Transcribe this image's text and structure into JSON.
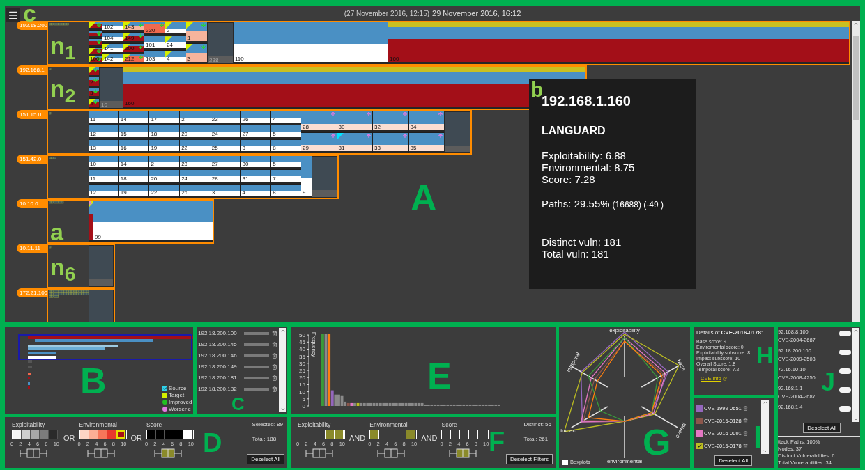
{
  "main": {
    "note": "A",
    "menu_note": "c",
    "previous_time": "(27 November 2016, 12:15)",
    "current_time": "29 November 2016, 16:12",
    "subnets": [
      {
        "label": "192.18.200",
        "note": "n$_{1}$",
        "blocks": [
          {
            "kind": "stack",
            "cells": [
              {
                "kind": "critical",
                "target": true,
                "improved": true
              },
              {
                "kind": "critical",
                "improved": true
              },
              {
                "kind": "critical",
                "improved": true
              },
              {
                "kind": "critical",
                "target": true,
                "improved": true
              },
              {
                "label": "100",
                "kind": "critical",
                "target": true,
                "improved": true
              }
            ]
          },
          {
            "kind": "stack",
            "cells": [
              {
                "label": "102",
                "kind": "safe"
              },
              {
                "label": "104",
                "kind": "safe"
              },
              {
                "label": "141",
                "kind": "safe",
                "target": true
              },
              {
                "label": "142",
                "kind": "safe",
                "target": true
              }
            ]
          },
          {
            "kind": "stack",
            "cells": [
              {
                "label": "143",
                "kind": "high",
                "target": true,
                "improved": true
              },
              {
                "label": "149",
                "kind": "critical",
                "target": true,
                "improved": true
              },
              {
                "label": "200",
                "kind": "critical",
                "target": true,
                "improved": true
              },
              {
                "label": "212",
                "kind": "severe",
                "target": true,
                "improved": true
              }
            ]
          },
          {
            "kind": "stack",
            "cells": [
              {
                "label": "230",
                "kind": "severe",
                "improved": true
              },
              {
                "label": "101",
                "kind": "safe"
              },
              {
                "label": "103",
                "kind": "safe"
              }
            ]
          },
          {
            "kind": "stack",
            "cells": [
              {
                "label": "2",
                "kind": "safe",
                "target": true
              },
              {
                "label": "24",
                "kind": "safe",
                "target": true
              },
              {
                "label": "4",
                "kind": "safe",
                "target": true
              }
            ]
          },
          {
            "kind": "stack",
            "cells": [
              {
                "label": "1",
                "kind": "high",
                "target": true,
                "improved": true
              },
              {
                "label": "3",
                "kind": "high",
                "target": true,
                "improved": true
              }
            ]
          },
          {
            "kind": "stack",
            "cells": [
              {
                "label": "238",
                "kind": "empty"
              }
            ]
          },
          {
            "kind": "wide",
            "cells": [
              {
                "label": "110",
                "kind": "safe"
              }
            ]
          },
          {
            "kind": "wide",
            "cells": [
              {
                "label": "160",
                "kind": "critical",
                "target": true
              }
            ]
          }
        ]
      },
      {
        "label": "192.168.1",
        "note": "n$_{2}$",
        "blocks": [
          {
            "kind": "stack",
            "cells": [
              {
                "kind": "critical",
                "target": true,
                "improved": true
              },
              {
                "label": "2",
                "kind": "critical",
                "improved": true
              },
              {
                "label": "3",
                "kind": "critical",
                "improved": true
              },
              {
                "label": "4",
                "kind": "critical",
                "target": true,
                "improved": true
              }
            ]
          },
          {
            "kind": "stack",
            "cells": [
              {
                "label": "10",
                "kind": "empty"
              }
            ]
          },
          {
            "kind": "wide",
            "cells": [
              {
                "label": "160",
                "kind": "critical",
                "target": true
              }
            ]
          }
        ]
      },
      {
        "label": "151.15.0",
        "blocks": [
          {
            "kind": "grid",
            "rows": [
              [
                {
                  "label": "11",
                  "kind": "safe"
                },
                {
                  "label": "14",
                  "kind": "safe"
                },
                {
                  "label": "17",
                  "kind": "safe"
                },
                {
                  "label": "2",
                  "kind": "safe"
                },
                {
                  "label": "23",
                  "kind": "safe"
                },
                {
                  "label": "26",
                  "kind": "safe"
                },
                {
                  "label": "4",
                  "kind": "safe"
                }
              ],
              [
                {
                  "label": "12",
                  "kind": "safe"
                },
                {
                  "label": "15",
                  "kind": "safe"
                },
                {
                  "label": "18",
                  "kind": "safe"
                },
                {
                  "label": "20",
                  "kind": "safe"
                },
                {
                  "label": "24",
                  "kind": "safe"
                },
                {
                  "label": "27",
                  "kind": "safe"
                },
                {
                  "label": "5",
                  "kind": "safe"
                }
              ],
              [
                {
                  "label": "13",
                  "kind": "safe"
                },
                {
                  "label": "16",
                  "kind": "safe"
                },
                {
                  "label": "19",
                  "kind": "safe"
                },
                {
                  "label": "22",
                  "kind": "safe"
                },
                {
                  "label": "25",
                  "kind": "safe"
                },
                {
                  "label": "3",
                  "kind": "safe"
                },
                {
                  "label": "8",
                  "kind": "safe"
                }
              ]
            ]
          },
          {
            "kind": "grid",
            "rows": [
              [
                {
                  "label": "28",
                  "kind": "medium",
                  "worsened": true
                },
                {
                  "label": "30",
                  "kind": "medium",
                  "worsened": true
                },
                {
                  "label": "32",
                  "kind": "medium",
                  "worsened": true
                },
                {
                  "label": "34",
                  "kind": "medium",
                  "worsened": true
                }
              ],
              [
                {
                  "label": "29",
                  "kind": "medium",
                  "worsened": true
                },
                {
                  "label": "31",
                  "kind": "medium",
                  "source": true,
                  "worsened": true
                },
                {
                  "label": "33",
                  "kind": "medium",
                  "worsened": true
                },
                {
                  "label": "35",
                  "kind": "medium",
                  "worsened": true
                }
              ]
            ]
          },
          {
            "kind": "stack",
            "cells": [
              {
                "kind": "empty"
              }
            ]
          }
        ]
      },
      {
        "label": "151.42.0",
        "blocks": [
          {
            "kind": "grid",
            "rows": [
              [
                {
                  "label": "10",
                  "kind": "safe"
                },
                {
                  "label": "14",
                  "kind": "safe"
                },
                {
                  "label": "2",
                  "kind": "safe"
                },
                {
                  "label": "23",
                  "kind": "safe"
                },
                {
                  "label": "27",
                  "kind": "safe"
                },
                {
                  "label": "30",
                  "kind": "safe"
                },
                {
                  "label": "5",
                  "kind": "safe"
                }
              ],
              [
                {
                  "label": "11",
                  "kind": "safe"
                },
                {
                  "label": "18",
                  "kind": "safe"
                },
                {
                  "label": "20",
                  "kind": "safe"
                },
                {
                  "label": "24",
                  "kind": "safe"
                },
                {
                  "label": "28",
                  "kind": "safe"
                },
                {
                  "label": "31",
                  "kind": "safe"
                },
                {
                  "label": "7",
                  "kind": "safe"
                }
              ],
              [
                {
                  "label": "12",
                  "kind": "safe"
                },
                {
                  "label": "19",
                  "kind": "safe"
                },
                {
                  "label": "22",
                  "kind": "safe"
                },
                {
                  "label": "26",
                  "kind": "safe"
                },
                {
                  "label": "3",
                  "kind": "safe"
                },
                {
                  "label": "4",
                  "kind": "safe"
                },
                {
                  "label": "8",
                  "kind": "safe"
                }
              ]
            ]
          },
          {
            "kind": "stack",
            "cells": [
              {
                "label": "9",
                "kind": "safe"
              }
            ]
          },
          {
            "kind": "stack",
            "cells": [
              {
                "kind": "empty"
              }
            ]
          }
        ]
      },
      {
        "label": "10.10.0",
        "note": "a",
        "blocks": [
          {
            "kind": "stack",
            "cells": [
              {
                "kind": "critical",
                "target": true,
                "worsened": true
              }
            ]
          },
          {
            "kind": "wide",
            "cells": [
              {
                "label": "99",
                "kind": "safe"
              }
            ]
          }
        ]
      },
      {
        "label": "10.11.11",
        "note": "n$_{6}$",
        "blocks": [
          {
            "kind": "stack",
            "cells": [
              {
                "kind": "empty"
              }
            ]
          }
        ]
      },
      {
        "label": "172.21.100",
        "blocks": [
          {
            "kind": "stack",
            "cells": [
              {
                "kind": "empty"
              }
            ]
          }
        ]
      }
    ],
    "tooltip": {
      "note": "b",
      "host": "192.168.1.160",
      "scanner": "LANGUARD",
      "metrics": [
        "Exploitability: 6.88",
        "Environmental: 8.75",
        "Score: 7.28"
      ],
      "paths": "Paths: 29.55%",
      "paths_detail": "(16688) (-49 )",
      "totals": [
        "Distinct vuln: 181",
        "Total vuln: 181"
      ]
    }
  },
  "overview": {
    "note": "B",
    "legend": [
      {
        "label": "Source",
        "kind": "source"
      },
      {
        "label": "Target",
        "kind": "target"
      },
      {
        "label": "Improved",
        "kind": "improved"
      },
      {
        "label": "Worsene",
        "kind": "worsened"
      }
    ]
  },
  "hosts": {
    "note": "C",
    "items": [
      "192.18.200.100",
      "192.18.200.145",
      "192.18.200.146",
      "192.18.200.149",
      "192.18.200.181",
      "192.18.200.182"
    ]
  },
  "score_filter": {
    "note": "D",
    "operators": [
      "OR",
      "OR"
    ],
    "filters": [
      {
        "title": "Exploitability",
        "boxplot_highlighted": false,
        "ticks": [
          "0",
          "2",
          "4",
          "6",
          "8",
          "10"
        ],
        "swatches": [
          {
            "color": "#f4f4f4",
            "selected": false
          },
          {
            "color": "#cfcfcf",
            "selected": false
          },
          {
            "color": "#a8a8a8",
            "selected": false
          },
          {
            "color": "#7c7c7c",
            "selected": false
          },
          {
            "color": "#2a2a2a",
            "selected": false
          }
        ]
      },
      {
        "title": "Environmental",
        "boxplot_highlighted": false,
        "ticks": [
          "0",
          "2",
          "4",
          "6",
          "8",
          "10"
        ],
        "swatches": [
          {
            "color": "#fdd5c5",
            "selected": false
          },
          {
            "color": "#fcae95",
            "selected": false
          },
          {
            "color": "#f7765a",
            "selected": false
          },
          {
            "color": "#e8392c",
            "selected": false
          },
          {
            "color": "#a50f15",
            "selected": true
          }
        ]
      },
      {
        "title": "Score",
        "boxplot_highlighted": true,
        "ticks": [
          "0",
          "2",
          "4",
          "6",
          "8",
          "10"
        ],
        "swatches": [
          {
            "color": "#000000",
            "selected": false
          },
          {
            "color": "#000000",
            "selected": false
          },
          {
            "color": "#000000",
            "selected": false
          },
          {
            "color": "#000000",
            "selected": false
          },
          {
            "color": "#ffffff",
            "selected": false
          }
        ]
      }
    ],
    "selected": "Selected: 89",
    "total": "Total: 188",
    "button": "Deselect All"
  },
  "frequency": {
    "note": "E",
    "chart_data": {
      "type": "bar",
      "ylabel": "Frequency",
      "categories": [
        null,
        null,
        null,
        null,
        null,
        null,
        null,
        null,
        null,
        null,
        null,
        null,
        null,
        null,
        null,
        null,
        null,
        null,
        null,
        null,
        null,
        null,
        null,
        null,
        null,
        null,
        null,
        null,
        null,
        null,
        null,
        null,
        null,
        null,
        null,
        null,
        null,
        null,
        null,
        null,
        null,
        null,
        null,
        null,
        null,
        null,
        null,
        null,
        null,
        null,
        null,
        null,
        null,
        null,
        null,
        null
      ],
      "stacked": true,
      "ylim": [
        0,
        52
      ],
      "yticks": [
        0,
        5,
        10,
        15,
        20,
        25,
        30,
        35,
        40,
        45,
        50
      ],
      "series": [
        {
          "color": "#3a9a3a",
          "values": [
            51,
            null,
            null,
            null,
            null,
            null,
            null,
            null,
            null,
            null,
            null,
            null,
            null,
            null,
            null,
            null,
            null,
            null,
            null,
            null,
            null,
            null,
            null,
            null,
            null,
            null,
            null,
            null,
            null,
            null,
            null,
            null,
            null,
            null,
            null,
            null,
            null,
            null,
            null,
            null,
            null,
            null,
            null,
            null,
            null,
            null,
            null,
            null,
            null,
            null,
            null,
            null,
            null,
            null,
            null,
            null
          ]
        },
        {
          "color": "#8a8a8a",
          "values": [
            null,
            51,
            null,
            null,
            8,
            8,
            7,
            3,
            null,
            null,
            2,
            null,
            2,
            2,
            2,
            2,
            2,
            2,
            2,
            2,
            2,
            2,
            2,
            2,
            2,
            2,
            2,
            2,
            2,
            2,
            2,
            2,
            1,
            1,
            1,
            1,
            1,
            1,
            1,
            1,
            1,
            1,
            1,
            1,
            1,
            1,
            1,
            1,
            1,
            1,
            1,
            1,
            1,
            1,
            1,
            1
          ]
        },
        {
          "color": "#ff7f0e",
          "values": [
            null,
            null,
            51,
            null,
            null,
            null,
            null,
            null,
            null,
            null,
            null,
            null,
            null,
            null,
            null,
            null,
            null,
            null,
            null,
            null,
            null,
            null,
            null,
            null,
            null,
            null,
            null,
            null,
            null,
            null,
            null,
            null,
            null,
            null,
            null,
            null,
            null,
            null,
            null,
            null,
            null,
            null,
            null,
            null,
            null,
            null,
            null,
            null,
            null,
            null,
            null,
            null,
            null,
            null,
            null,
            null
          ]
        },
        {
          "color": "#9467bd",
          "values": [
            null,
            null,
            null,
            11,
            null,
            null,
            null,
            null,
            null,
            null,
            null,
            null,
            null,
            null,
            null,
            null,
            null,
            null,
            null,
            null,
            null,
            null,
            null,
            null,
            null,
            null,
            null,
            null,
            null,
            null,
            null,
            null,
            null,
            null,
            null,
            null,
            null,
            null,
            null,
            null,
            null,
            null,
            null,
            null,
            null,
            null,
            null,
            null,
            null,
            null,
            null,
            null,
            null,
            null,
            null,
            null
          ]
        },
        {
          "color": "#8c564b",
          "values": [
            null,
            null,
            null,
            null,
            null,
            null,
            null,
            null,
            2,
            null,
            null,
            null,
            null,
            null,
            null,
            null,
            null,
            null,
            null,
            null,
            null,
            null,
            null,
            null,
            null,
            null,
            null,
            null,
            null,
            null,
            null,
            null,
            null,
            null,
            null,
            null,
            null,
            null,
            null,
            null,
            null,
            null,
            null,
            null,
            null,
            null,
            null,
            null,
            null,
            null,
            null,
            null,
            null,
            null,
            null,
            null
          ]
        },
        {
          "color": "#e377c2",
          "values": [
            null,
            null,
            null,
            null,
            null,
            null,
            null,
            null,
            null,
            2,
            null,
            null,
            null,
            null,
            null,
            null,
            null,
            null,
            null,
            null,
            null,
            null,
            null,
            null,
            null,
            null,
            null,
            null,
            null,
            null,
            null,
            null,
            null,
            null,
            null,
            null,
            null,
            null,
            null,
            null,
            null,
            null,
            null,
            null,
            null,
            null,
            null,
            null,
            null,
            null,
            null,
            null,
            null,
            null,
            null,
            null
          ]
        },
        {
          "color": "#bcbd22",
          "values": [
            null,
            null,
            null,
            null,
            null,
            null,
            null,
            null,
            null,
            null,
            null,
            2,
            null,
            null,
            null,
            null,
            null,
            null,
            null,
            null,
            null,
            null,
            null,
            null,
            null,
            null,
            null,
            null,
            null,
            null,
            null,
            null,
            null,
            null,
            null,
            null,
            null,
            null,
            null,
            null,
            null,
            null,
            null,
            null,
            null,
            null,
            null,
            null,
            null,
            null,
            null,
            null,
            null,
            null,
            null,
            null
          ]
        }
      ]
    }
  },
  "vuln_filter": {
    "note": "F",
    "operators": [
      "AND",
      "AND"
    ],
    "filters": [
      {
        "title": "Exploitability",
        "boxplot_highlighted": false,
        "ticks": [
          "0",
          "2",
          "4",
          "6",
          "8",
          "10"
        ],
        "cells": [
          {
            "selected": false
          },
          {
            "selected": false
          },
          {
            "selected": false
          },
          {
            "selected": true
          },
          {
            "selected": true
          }
        ]
      },
      {
        "title": "Environmental",
        "boxplot_highlighted": false,
        "ticks": [
          "0",
          "2",
          "4",
          "6",
          "8",
          "10"
        ],
        "cells": [
          {
            "selected": true
          },
          {
            "selected": false
          },
          {
            "selected": false
          },
          {
            "selected": false
          },
          {
            "selected": true
          }
        ]
      },
      {
        "title": "Score",
        "boxplot_highlighted": true,
        "ticks": [
          "0",
          "2",
          "4",
          "6",
          "8",
          "10"
        ],
        "cells": [
          {
            "selected": false
          },
          {
            "selected": false
          },
          {
            "selected": false
          },
          {
            "selected": false
          },
          {
            "selected": false
          }
        ]
      }
    ],
    "distinct": "Distinct: 56",
    "total": "Total: 261",
    "button": "Deselect Filters"
  },
  "radar": {
    "note": "G",
    "axes": [
      "exploitability",
      "base",
      "overall",
      "environmental",
      "impact",
      "temporal"
    ],
    "checkbox": {
      "label": "Boxplots",
      "checked": false
    }
  },
  "details": {
    "note": "H",
    "title": "Details of **CVE-2016-0178**:",
    "lines": [
      "Base score: 9",
      "Enviromental score: 0",
      "Exploitability subscore: 8",
      "Impact subscore: 10",
      "Overall Score: 1.8",
      "Temporal score: 7.2"
    ],
    "link": "CVE info"
  },
  "selection": {
    "note": "I",
    "items": [
      {
        "label": "CVE-1999-0651",
        "color": "#9467bd",
        "checked": false
      },
      {
        "label": "CVE-2016-0128",
        "color": "#8c564b",
        "checked": false
      },
      {
        "label": "CVE-2016-0091",
        "color": "#e377c2",
        "checked": false
      },
      {
        "label": "CVE-2016-0178",
        "color": "#bcbd22",
        "checked": true
      }
    ],
    "button": "Deselect All"
  },
  "pairs": {
    "note": "J",
    "items": [
      {
        "host": "92.168.8.100",
        "cve": "CVE-2004-2687",
        "on": false
      },
      {
        "host": "92.18.200.160",
        "cve": "CVE-2009-2503",
        "on": false
      },
      {
        "host": "72.16.10.10",
        "cve": "CVE-2008-4250",
        "on": false
      },
      {
        "host": "92.168.1.1",
        "cve": "CVE-2004-2687",
        "on": false
      },
      {
        "host": "92.168.1.4",
        "on": false
      }
    ],
    "button": "Deselect All",
    "stats": [
      "ttack Paths: 100%",
      "Nodes: 37",
      "Distinct Vulnerabilities: 6",
      "Total Vulnerabilities: 34"
    ]
  }
}
